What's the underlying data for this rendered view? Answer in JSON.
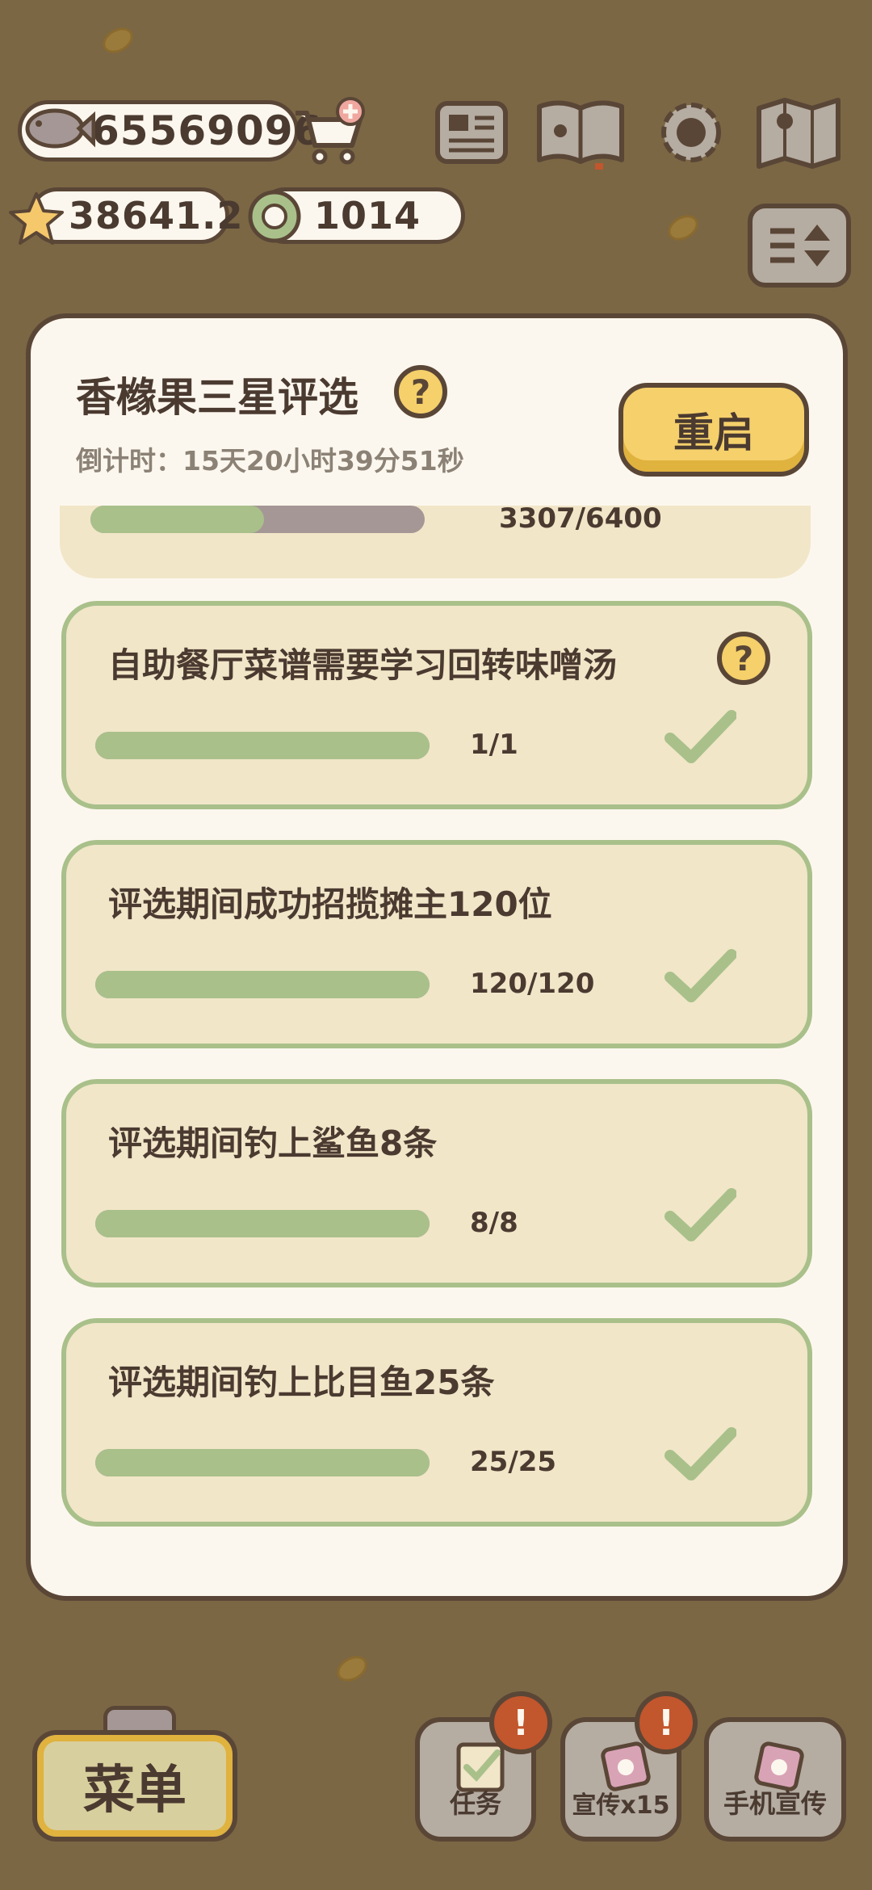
{
  "currency": {
    "fish": "65569096",
    "stars": "38641.2",
    "rings": "1014"
  },
  "modal": {
    "title": "香橼果三星评选",
    "countdown": "倒计时：15天20小时39分51秒",
    "restart_label": "重启",
    "partial_task_progress": "3307/6400",
    "partial_task_fraction": 0.52,
    "tasks": [
      {
        "title": "自助餐厅菜谱需要学习回转味噌汤",
        "progress": "1/1",
        "fraction": 1.0,
        "has_help": true
      },
      {
        "title": "评选期间成功招揽摊主120位",
        "progress": "120/120",
        "fraction": 1.0,
        "has_help": false
      },
      {
        "title": "评选期间钓上鲨鱼8条",
        "progress": "8/8",
        "fraction": 1.0,
        "has_help": false
      },
      {
        "title": "评选期间钓上比目鱼25条",
        "progress": "25/25",
        "fraction": 1.0,
        "has_help": false
      }
    ]
  },
  "bottom": {
    "menu_label": "菜单",
    "tasks_label": "任务",
    "promo_label": "宣传x15",
    "phone_promo_label": "手机宣传",
    "alert_mark": "!"
  },
  "icons": {
    "fish": "fish-icon",
    "cart": "cart-plus-icon",
    "star": "star-icon",
    "ring": "ring-icon",
    "newspaper": "newspaper-icon",
    "book": "paw-book-icon",
    "settings": "gear-icon",
    "map": "map-icon",
    "swap": "swap-icon",
    "help": "help-icon",
    "check": "check-icon"
  },
  "colors": {
    "panel": "#fcf7ee",
    "card": "#f1e6c8",
    "card_border": "#a9c08a",
    "progress_fill": "#a9c08a",
    "progress_track": "#a59795",
    "button_yellow": "#f5d06b",
    "outline": "#5a4636",
    "alert": "#c2562d"
  }
}
